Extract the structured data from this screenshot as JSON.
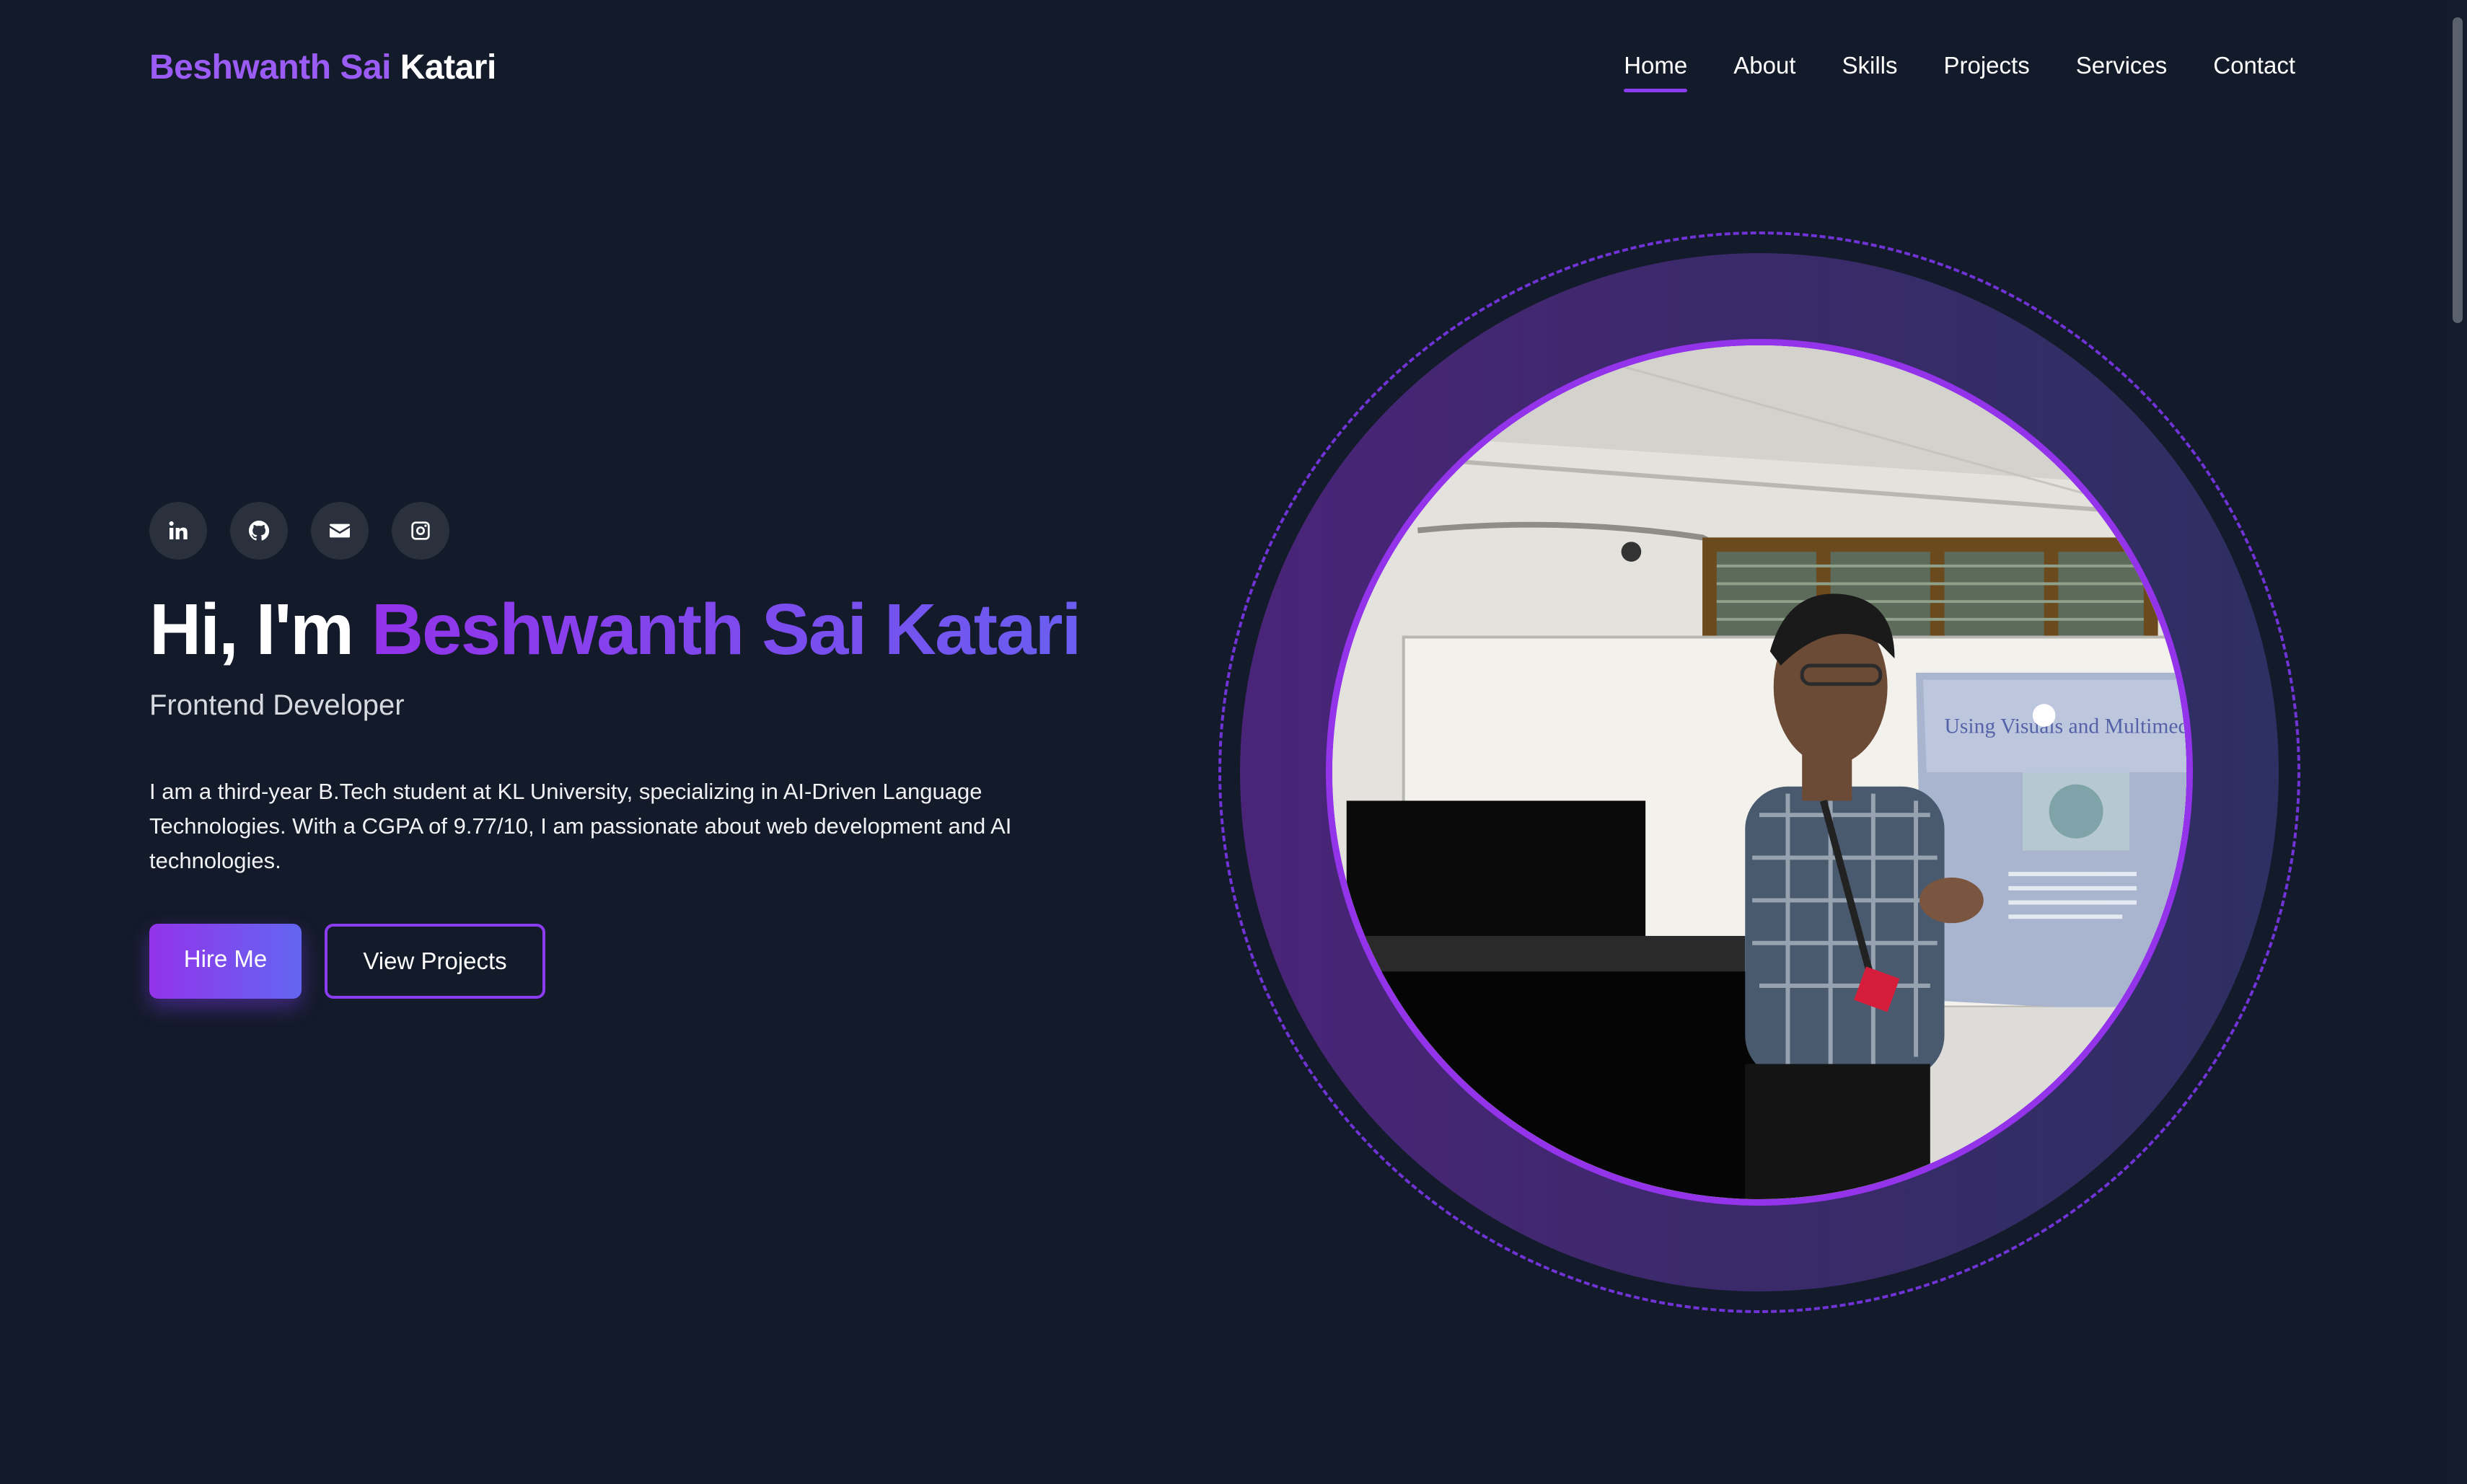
{
  "logo": {
    "first": "Beshwanth Sai",
    "last": "Katari"
  },
  "nav": {
    "items": [
      {
        "label": "Home",
        "active": true
      },
      {
        "label": "About"
      },
      {
        "label": "Skills"
      },
      {
        "label": "Projects"
      },
      {
        "label": "Services"
      },
      {
        "label": "Contact"
      }
    ]
  },
  "socials": [
    {
      "icon": "linkedin-icon"
    },
    {
      "icon": "github-icon"
    },
    {
      "icon": "email-icon"
    },
    {
      "icon": "instagram-icon"
    }
  ],
  "hero": {
    "greeting": "Hi, I'm",
    "name": "Beshwanth Sai Katari",
    "role": "Frontend Developer",
    "description": "I am a third-year B.Tech student at KL University, specializing in AI-Driven Language Technologies. With a CGPA of 9.77/10, I am passionate about web development and AI technologies.",
    "hire_label": "Hire Me",
    "projects_label": "View Projects"
  },
  "photo": {
    "slide_title": "Using Visuals and Multimedia"
  },
  "colors": {
    "background": "#131a29",
    "accent": "#9333ea",
    "accent_2": "#6366f1"
  }
}
